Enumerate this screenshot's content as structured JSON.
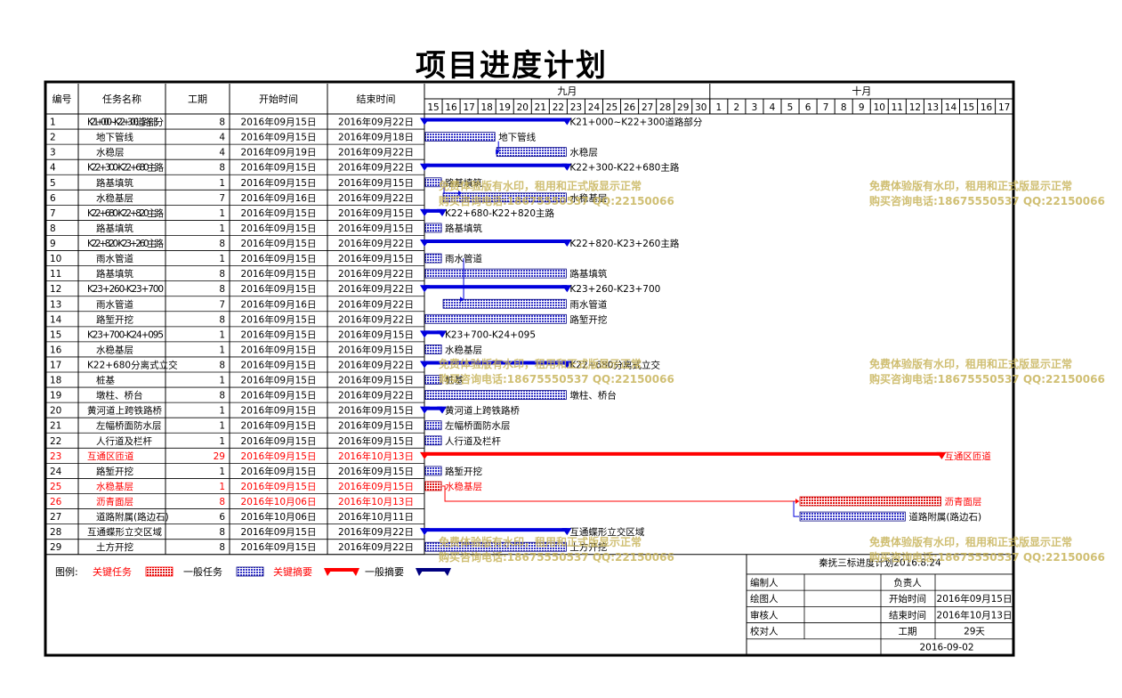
{
  "page": {
    "title": "项目进度计划",
    "headers": {
      "id": "编号",
      "name": "任务名称",
      "duration": "工期",
      "start": "开始时间",
      "end": "结束时间"
    },
    "months": [
      "九月",
      "十月"
    ],
    "days": [
      15,
      16,
      17,
      18,
      19,
      20,
      21,
      22,
      23,
      24,
      25,
      26,
      27,
      28,
      29,
      30,
      1,
      2,
      3,
      4,
      5,
      6,
      7,
      8,
      9,
      10,
      11,
      12,
      13,
      14,
      15,
      16,
      17
    ],
    "watermark": {
      "line1": "免费体验版有水印，租用和正式版显示正常",
      "line2": "购买咨询电话:18675550537 QQ:22150066"
    },
    "legend": {
      "label": "图例:",
      "items": [
        {
          "text": "关键任务",
          "color": "#ff0000",
          "kind": "critical-task"
        },
        {
          "text": "一般任务",
          "color": "#000080",
          "kind": "task"
        },
        {
          "text": "关键摘要",
          "color": "#ff0000",
          "kind": "critical-summary"
        },
        {
          "text": "一般摘要",
          "color": "#000080",
          "kind": "summary"
        }
      ]
    },
    "info": {
      "title": "秦抚三标进度计划2016.8.24",
      "editor_label": "编制人",
      "owner_label": "负责人",
      "drawer_label": "绘图人",
      "start_label": "开始时间",
      "start_value": "2016年09月15日",
      "reviewer_label": "审核人",
      "end_label": "结束时间",
      "end_value": "2016年10月13日",
      "checker_label": "校对人",
      "duration_label": "工期",
      "duration_value": "29天",
      "date": "2016-09-02"
    },
    "colors": {
      "critical": "#ff0000",
      "normal": "#0000dd",
      "task_fill": "#6b6bd6"
    }
  },
  "chart_data": {
    "type": "gantt",
    "date_range": [
      "2016-09-15",
      "2016-10-17"
    ],
    "tasks": [
      {
        "id": "1",
        "name": "K21+000~K22+300道路部分",
        "duration": "8",
        "start": "2016年09月15日",
        "end": "2016年09月22日",
        "start_day": "2016-09-15",
        "end_day": "2016-09-22",
        "type": "summary",
        "critical": false,
        "bar_label": "K21+000~K22+300道路部分"
      },
      {
        "id": "2",
        "name": "地下管线",
        "duration": "4",
        "start": "2016年09月15日",
        "end": "2016年09月18日",
        "start_day": "2016-09-15",
        "end_day": "2016-09-18",
        "type": "task",
        "critical": false,
        "bar_label": "地下管线"
      },
      {
        "id": "3",
        "name": "水稳层",
        "duration": "4",
        "start": "2016年09月19日",
        "end": "2016年09月22日",
        "start_day": "2016-09-19",
        "end_day": "2016-09-22",
        "type": "task",
        "critical": false,
        "bar_label": "水稳层"
      },
      {
        "id": "4",
        "name": "K22+300-K22+680主路",
        "duration": "8",
        "start": "2016年09月15日",
        "end": "2016年09月22日",
        "start_day": "2016-09-15",
        "end_day": "2016-09-22",
        "type": "summary",
        "critical": false,
        "bar_label": "K22+300-K22+680主路"
      },
      {
        "id": "5",
        "name": "路基填筑",
        "duration": "1",
        "start": "2016年09月15日",
        "end": "2016年09月15日",
        "start_day": "2016-09-15",
        "end_day": "2016-09-15",
        "type": "task",
        "critical": false,
        "bar_label": "路基填筑"
      },
      {
        "id": "6",
        "name": "水稳基层",
        "duration": "7",
        "start": "2016年09月16日",
        "end": "2016年09月22日",
        "start_day": "2016-09-16",
        "end_day": "2016-09-22",
        "type": "task",
        "critical": false,
        "bar_label": "水稳基层"
      },
      {
        "id": "7",
        "name": "K22+680-K22+820主路",
        "duration": "1",
        "start": "2016年09月15日",
        "end": "2016年09月15日",
        "start_day": "2016-09-15",
        "end_day": "2016-09-15",
        "type": "summary",
        "critical": false,
        "bar_label": "K22+680-K22+820主路"
      },
      {
        "id": "8",
        "name": "路基填筑",
        "duration": "1",
        "start": "2016年09月15日",
        "end": "2016年09月15日",
        "start_day": "2016-09-15",
        "end_day": "2016-09-15",
        "type": "task",
        "critical": false,
        "bar_label": "路基填筑"
      },
      {
        "id": "9",
        "name": "K22+820-K23+260主路",
        "duration": "8",
        "start": "2016年09月15日",
        "end": "2016年09月22日",
        "start_day": "2016-09-15",
        "end_day": "2016-09-22",
        "type": "summary",
        "critical": false,
        "bar_label": "K22+820-K23+260主路"
      },
      {
        "id": "10",
        "name": "雨水管道",
        "duration": "1",
        "start": "2016年09月15日",
        "end": "2016年09月15日",
        "start_day": "2016-09-15",
        "end_day": "2016-09-15",
        "type": "task",
        "critical": false,
        "bar_label": "雨水管道"
      },
      {
        "id": "11",
        "name": "路基填筑",
        "duration": "8",
        "start": "2016年09月15日",
        "end": "2016年09月22日",
        "start_day": "2016-09-15",
        "end_day": "2016-09-22",
        "type": "task",
        "critical": false,
        "bar_label": "路基填筑"
      },
      {
        "id": "12",
        "name": "K23+260-K23+700",
        "duration": "8",
        "start": "2016年09月15日",
        "end": "2016年09月22日",
        "start_day": "2016-09-15",
        "end_day": "2016-09-22",
        "type": "summary",
        "critical": false,
        "bar_label": "K23+260-K23+700"
      },
      {
        "id": "13",
        "name": "雨水管道",
        "duration": "7",
        "start": "2016年09月16日",
        "end": "2016年09月22日",
        "start_day": "2016-09-16",
        "end_day": "2016-09-22",
        "type": "task",
        "critical": false,
        "bar_label": "雨水管道"
      },
      {
        "id": "14",
        "name": "路堑开挖",
        "duration": "8",
        "start": "2016年09月15日",
        "end": "2016年09月22日",
        "start_day": "2016-09-15",
        "end_day": "2016-09-22",
        "type": "task",
        "critical": false,
        "bar_label": "路堑开挖"
      },
      {
        "id": "15",
        "name": "K23+700-K24+095",
        "duration": "1",
        "start": "2016年09月15日",
        "end": "2016年09月15日",
        "start_day": "2016-09-15",
        "end_day": "2016-09-15",
        "type": "summary",
        "critical": false,
        "bar_label": "K23+700-K24+095"
      },
      {
        "id": "16",
        "name": "水稳基层",
        "duration": "1",
        "start": "2016年09月15日",
        "end": "2016年09月15日",
        "start_day": "2016-09-15",
        "end_day": "2016-09-15",
        "type": "task",
        "critical": false,
        "bar_label": "水稳基层"
      },
      {
        "id": "17",
        "name": "K22+680分离式立交",
        "duration": "8",
        "start": "2016年09月15日",
        "end": "2016年09月22日",
        "start_day": "2016-09-15",
        "end_day": "2016-09-22",
        "type": "summary",
        "critical": false,
        "bar_label": "K22+680分离式立交"
      },
      {
        "id": "18",
        "name": "桩基",
        "duration": "1",
        "start": "2016年09月15日",
        "end": "2016年09月15日",
        "start_day": "2016-09-15",
        "end_day": "2016-09-15",
        "type": "task",
        "critical": false,
        "bar_label": "桩基"
      },
      {
        "id": "19",
        "name": "墩柱、桥台",
        "duration": "8",
        "start": "2016年09月15日",
        "end": "2016年09月22日",
        "start_day": "2016-09-15",
        "end_day": "2016-09-22",
        "type": "task",
        "critical": false,
        "bar_label": "墩柱、桥台"
      },
      {
        "id": "20",
        "name": "黄河道上跨铁路桥",
        "duration": "1",
        "start": "2016年09月15日",
        "end": "2016年09月15日",
        "start_day": "2016-09-15",
        "end_day": "2016-09-15",
        "type": "summary",
        "critical": false,
        "bar_label": "黄河道上跨铁路桥"
      },
      {
        "id": "21",
        "name": "左幅桥面防水层",
        "duration": "1",
        "start": "2016年09月15日",
        "end": "2016年09月15日",
        "start_day": "2016-09-15",
        "end_day": "2016-09-15",
        "type": "task",
        "critical": false,
        "bar_label": "左幅桥面防水层"
      },
      {
        "id": "22",
        "name": "人行道及栏杆",
        "duration": "1",
        "start": "2016年09月15日",
        "end": "2016年09月15日",
        "start_day": "2016-09-15",
        "end_day": "2016-09-15",
        "type": "task",
        "critical": false,
        "bar_label": "人行道及栏杆"
      },
      {
        "id": "23",
        "name": "互通区匝道",
        "duration": "29",
        "start": "2016年09月15日",
        "end": "2016年10月13日",
        "start_day": "2016-09-15",
        "end_day": "2016-10-13",
        "type": "summary",
        "critical": true,
        "bar_label": "互通区匝道"
      },
      {
        "id": "24",
        "name": "路堑开挖",
        "duration": "1",
        "start": "2016年09月15日",
        "end": "2016年09月15日",
        "start_day": "2016-09-15",
        "end_day": "2016-09-15",
        "type": "task",
        "critical": false,
        "bar_label": "路堑开挖"
      },
      {
        "id": "25",
        "name": "水稳基层",
        "duration": "1",
        "start": "2016年09月15日",
        "end": "2016年09月15日",
        "start_day": "2016-09-15",
        "end_day": "2016-09-15",
        "type": "task",
        "critical": true,
        "bar_label": "水稳基层"
      },
      {
        "id": "26",
        "name": "沥青面层",
        "duration": "8",
        "start": "2016年10月06日",
        "end": "2016年10月13日",
        "start_day": "2016-10-06",
        "end_day": "2016-10-13",
        "type": "task",
        "critical": true,
        "bar_label": "沥青面层"
      },
      {
        "id": "27",
        "name": "道路附属(路边石)",
        "duration": "6",
        "start": "2016年10月06日",
        "end": "2016年10月11日",
        "start_day": "2016-10-06",
        "end_day": "2016-10-11",
        "type": "task",
        "critical": false,
        "bar_label": "道路附属(路边石)"
      },
      {
        "id": "28",
        "name": "互通蝶形立交区域",
        "duration": "8",
        "start": "2016年09月15日",
        "end": "2016年09月22日",
        "start_day": "2016-09-15",
        "end_day": "2016-09-22",
        "type": "summary",
        "critical": false,
        "bar_label": "互通蝶形立交区域"
      },
      {
        "id": "29",
        "name": "土方开挖",
        "duration": "8",
        "start": "2016年09月15日",
        "end": "2016年09月22日",
        "start_day": "2016-09-15",
        "end_day": "2016-09-22",
        "type": "task",
        "critical": false,
        "bar_label": "土方开挖"
      }
    ]
  }
}
